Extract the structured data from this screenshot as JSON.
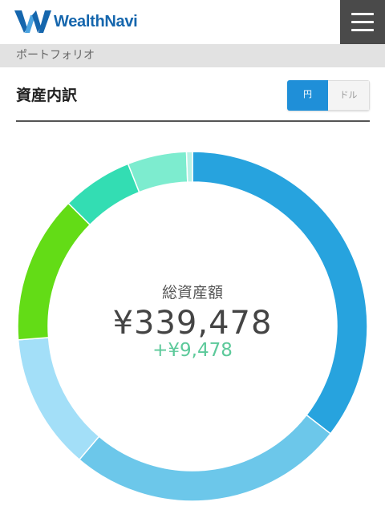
{
  "header": {
    "logo_text": "WealthNavi",
    "logo_color": "#1566ad",
    "menu_icon": "hamburger-menu-icon",
    "menu_bg": "#4a4a4a"
  },
  "breadcrumb": {
    "label": "ポートフォリオ"
  },
  "section": {
    "title": "資産内訳"
  },
  "currency_toggle": {
    "options": [
      "円",
      "ドル"
    ],
    "selected": "円",
    "active_color": "#1f8fd8"
  },
  "summary": {
    "label": "総資産額",
    "total": "¥339,478",
    "change": "+¥9,478",
    "change_color": "#5cc99a"
  },
  "chart_data": {
    "type": "pie",
    "variant": "donut",
    "values": [
      32.5,
      23.5,
      11.5,
      12.5,
      6.0,
      5.0,
      0.5
    ],
    "colors": [
      "#27a3de",
      "#6cc7ea",
      "#a3dff8",
      "#63dc16",
      "#33ddb3",
      "#7deccf",
      "#b9f2e6"
    ]
  }
}
